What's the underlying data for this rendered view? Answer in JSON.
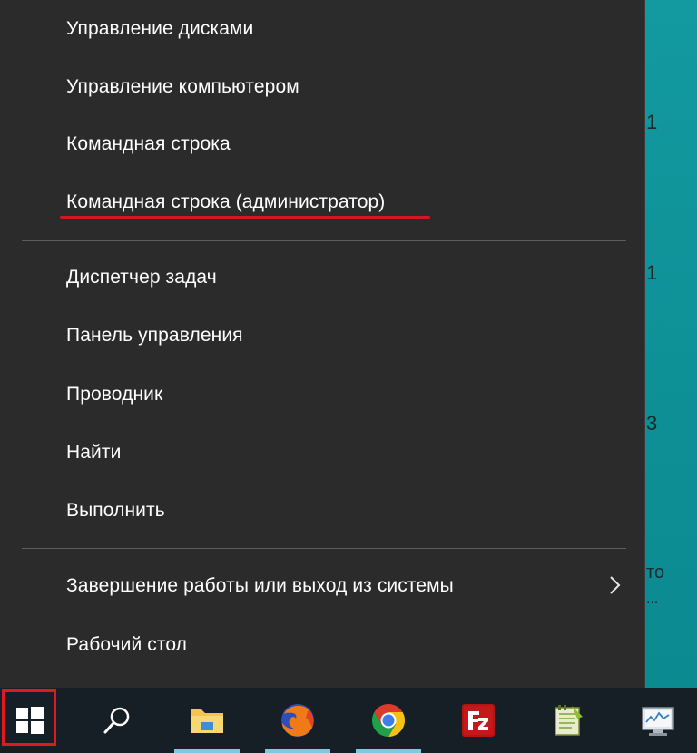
{
  "menu": {
    "items": [
      {
        "label": "Управление дисками"
      },
      {
        "label": "Управление компьютером"
      },
      {
        "label": "Командная строка"
      },
      {
        "label": "Командная строка (администратор)"
      },
      {
        "label": "Диспетчер задач"
      },
      {
        "label": "Панель управления"
      },
      {
        "label": "Проводник"
      },
      {
        "label": "Найти"
      },
      {
        "label": "Выполнить"
      },
      {
        "label": "Завершение работы или выход из системы"
      },
      {
        "label": "Рабочий стол"
      }
    ],
    "highlighted_item": "Командная строка (администратор)",
    "highlight_color": "#d8151b"
  },
  "desktop": {
    "fragments": [
      "1",
      "1",
      "3",
      "то",
      "..."
    ]
  },
  "taskbar": {
    "start_highlight_color": "#e01920",
    "pinned": [
      {
        "icon": "search-icon"
      },
      {
        "icon": "file-explorer-icon"
      },
      {
        "icon": "firefox-icon"
      },
      {
        "icon": "chrome-icon"
      },
      {
        "icon": "filezilla-icon"
      },
      {
        "icon": "notepad-plus-icon"
      },
      {
        "icon": "resource-monitor-icon"
      }
    ]
  }
}
